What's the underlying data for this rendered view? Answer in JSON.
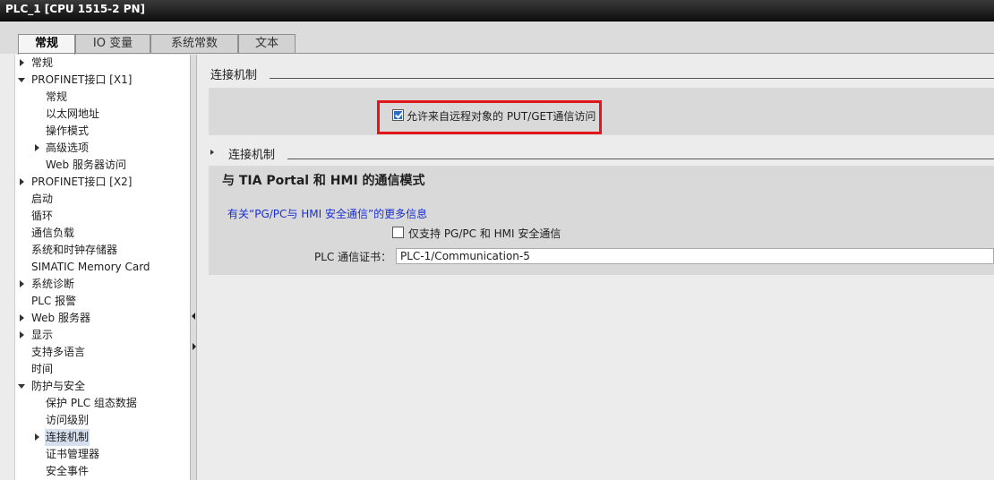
{
  "window": {
    "title": "PLC_1 [CPU 1515-2 PN]"
  },
  "tabs": [
    "常规",
    "IO 变量",
    "系统常数",
    "文本"
  ],
  "sidebar": {
    "items": [
      {
        "label": "常规",
        "arrow": "right"
      },
      {
        "label": "PROFINET接口 [X1]",
        "arrow": "down"
      },
      {
        "label": "常规",
        "arrow": ""
      },
      {
        "label": "以太网地址",
        "arrow": ""
      },
      {
        "label": "操作模式",
        "arrow": ""
      },
      {
        "label": "高级选项",
        "arrow": "right"
      },
      {
        "label": "Web 服务器访问",
        "arrow": ""
      },
      {
        "label": "PROFINET接口 [X2]",
        "arrow": "right"
      },
      {
        "label": "启动",
        "arrow": ""
      },
      {
        "label": "循环",
        "arrow": ""
      },
      {
        "label": "通信负载",
        "arrow": ""
      },
      {
        "label": "系统和时钟存储器",
        "arrow": ""
      },
      {
        "label": "SIMATIC Memory Card",
        "arrow": ""
      },
      {
        "label": "系统诊断",
        "arrow": "right"
      },
      {
        "label": "PLC 报警",
        "arrow": ""
      },
      {
        "label": "Web 服务器",
        "arrow": "right"
      },
      {
        "label": "显示",
        "arrow": "right"
      },
      {
        "label": "支持多语言",
        "arrow": ""
      },
      {
        "label": "时间",
        "arrow": ""
      },
      {
        "label": "防护与安全",
        "arrow": "down"
      },
      {
        "label": "保护 PLC 组态数据",
        "arrow": ""
      },
      {
        "label": "访问级别",
        "arrow": ""
      },
      {
        "label": "连接机制",
        "arrow": "right",
        "selected": true
      },
      {
        "label": "证书管理器",
        "arrow": ""
      },
      {
        "label": "安全事件",
        "arrow": ""
      }
    ]
  },
  "main": {
    "section1_title": "连接机制",
    "put_get_label": "允许来自远程对象的 PUT/GET通信访问",
    "section2_title": "连接机制",
    "panel_title": "与 TIA Portal 和 HMI 的通信模式",
    "info_link": "有关“PG/PC与 HMI 安全通信”的更多信息",
    "secure_only_label": "仅支持 PG/PC 和 HMI 安全通信",
    "cert_label": "PLC 通信证书：",
    "cert_value": "PLC-1/Communication-5"
  },
  "colors": {
    "accent": "#e0161b",
    "link": "#1a2fd6",
    "check": "#2a6fc4"
  }
}
